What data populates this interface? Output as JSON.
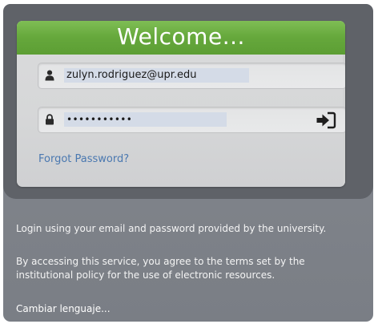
{
  "login_card": {
    "title": "Welcome...",
    "email": {
      "icon": "user-icon",
      "value": "zulyn.rodriguez@upr.edu"
    },
    "password": {
      "icon": "lock-icon",
      "value": "•••••••••••"
    },
    "login_button_icon": "sign-in-icon",
    "forgot_password": "Forgot Password?"
  },
  "info": {
    "login_instructions": "Login using your email and password provided by the university.",
    "terms_notice": "By accessing this service, you agree to the terms set by the institutional policy for the use of electronic resources."
  },
  "language_link": "Cambiar lenguaje...",
  "colors": {
    "header_green": "#66a83c",
    "link_blue": "#4a78b0",
    "background_gray": "#80848b"
  }
}
